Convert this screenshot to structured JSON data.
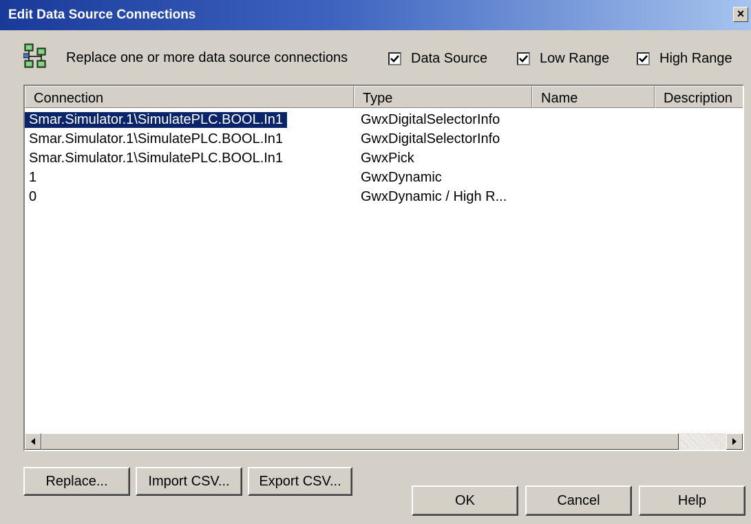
{
  "window": {
    "title": "Edit Data Source Connections",
    "close_glyph": "×"
  },
  "instruction": "Replace one or more data source connections",
  "checkboxes": [
    {
      "label": "Data Source",
      "checked": true
    },
    {
      "label": "Low Range",
      "checked": true
    },
    {
      "label": "High Range",
      "checked": true
    }
  ],
  "table": {
    "columns": [
      "Connection",
      "Type",
      "Name",
      "Description"
    ],
    "rows": [
      {
        "connection": "Smar.Simulator.1\\SimulatePLC.BOOL.In1",
        "type": "GwxDigitalSelectorInfo",
        "name": "",
        "description": "",
        "selected": true
      },
      {
        "connection": "Smar.Simulator.1\\SimulatePLC.BOOL.In1",
        "type": "GwxDigitalSelectorInfo",
        "name": "",
        "description": ""
      },
      {
        "connection": "Smar.Simulator.1\\SimulatePLC.BOOL.In1",
        "type": "GwxPick",
        "name": "",
        "description": ""
      },
      {
        "connection": "1",
        "type": "GwxDynamic",
        "name": "",
        "description": ""
      },
      {
        "connection": "0",
        "type": "GwxDynamic / High R...",
        "name": "",
        "description": ""
      }
    ]
  },
  "buttons": {
    "replace": "Replace...",
    "import_csv": "Import CSV...",
    "export_csv": "Export CSV...",
    "ok": "OK",
    "cancel": "Cancel",
    "help": "Help"
  },
  "icons": {
    "dialog": "network-connections-icon",
    "scroll_left": "arrow-left-icon",
    "scroll_right": "arrow-right-icon",
    "check": "checkmark-icon"
  },
  "colors": {
    "title_start": "#1a3a9a",
    "title_end": "#a6c4ee",
    "selection": "#0a246a",
    "face": "#d4d0c8"
  }
}
